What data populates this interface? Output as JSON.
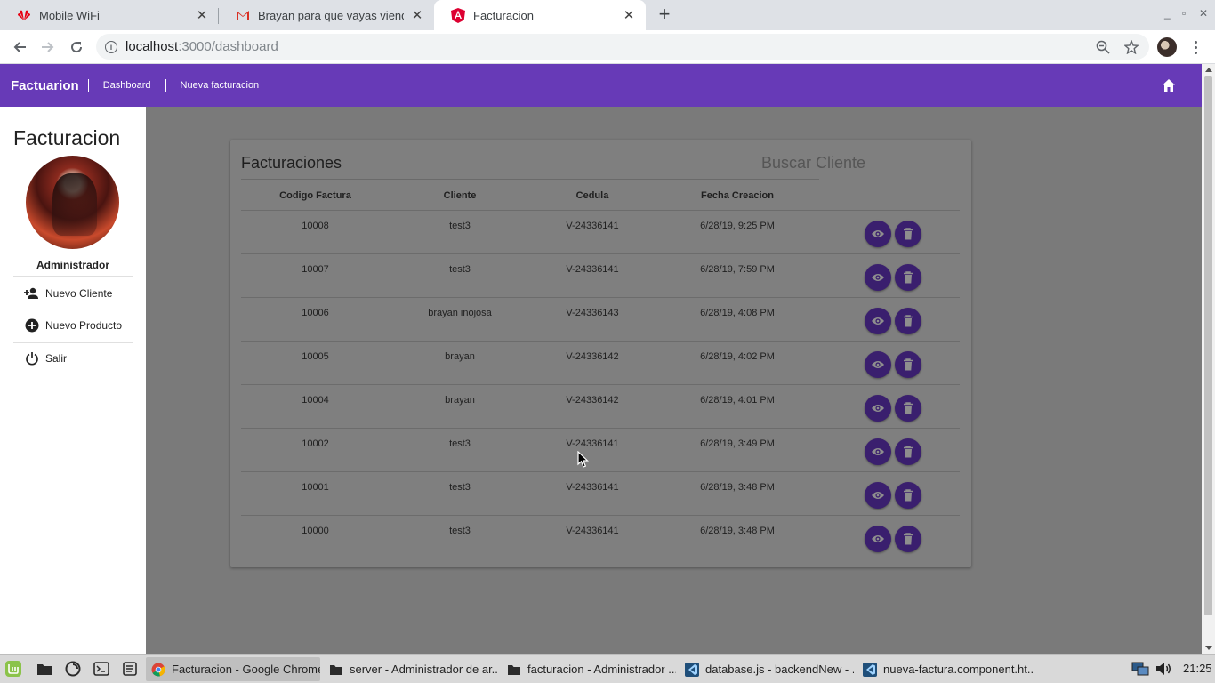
{
  "browser": {
    "tabs": [
      {
        "title": "Mobile WiFi",
        "icon": "huawei-logo-icon",
        "active": false
      },
      {
        "title": "Brayan para que vayas viendo",
        "icon": "gmail-icon",
        "active": false
      },
      {
        "title": "Facturacion",
        "icon": "angular-logo-icon",
        "active": true
      }
    ],
    "address": {
      "host": "localhost",
      "path": ":3000/dashboard"
    }
  },
  "header": {
    "brand": "Factuarion",
    "nav": [
      "Dashboard",
      "Nueva facturacion"
    ]
  },
  "sidebar": {
    "title": "Facturacion",
    "role": "Administrador",
    "items": [
      {
        "label": "Nuevo Cliente",
        "icon": "person-add-icon"
      },
      {
        "label": "Nuevo Producto",
        "icon": "add-circle-icon"
      },
      {
        "label": "Salir",
        "icon": "power-icon"
      }
    ]
  },
  "main": {
    "card_title": "Facturaciones",
    "search_label": "Buscar Cliente",
    "columns": [
      "Codigo Factura",
      "Cliente",
      "Cedula",
      "Fecha Creacion"
    ],
    "rows": [
      [
        "10008",
        "test3",
        "V-24336141",
        "6/28/19, 9:25 PM"
      ],
      [
        "10007",
        "test3",
        "V-24336141",
        "6/28/19, 7:59 PM"
      ],
      [
        "10006",
        "brayan inojosa",
        "V-24336143",
        "6/28/19, 4:08 PM"
      ],
      [
        "10005",
        "brayan",
        "V-24336142",
        "6/28/19, 4:02 PM"
      ],
      [
        "10004",
        "brayan",
        "V-24336142",
        "6/28/19, 4:01 PM"
      ],
      [
        "10002",
        "test3",
        "V-24336141",
        "6/28/19, 3:49 PM"
      ],
      [
        "10001",
        "test3",
        "V-24336141",
        "6/28/19, 3:48 PM"
      ],
      [
        "10000",
        "test3",
        "V-24336141",
        "6/28/19, 3:48 PM"
      ]
    ]
  },
  "taskbar": {
    "tasks": [
      {
        "label": "Facturacion - Google Chrome",
        "icon": "chrome-icon",
        "active": true
      },
      {
        "label": "server - Administrador de ar...",
        "icon": "folder-icon",
        "active": false
      },
      {
        "label": "facturacion - Administrador ...",
        "icon": "folder-icon",
        "active": false
      },
      {
        "label": "database.js - backendNew - ...",
        "icon": "vscode-icon",
        "active": false
      },
      {
        "label": "nueva-factura.component.ht...",
        "icon": "vscode-icon",
        "active": false
      }
    ],
    "clock": "21:25"
  },
  "colors": {
    "primary": "#673ab7",
    "action_button": "#3a1f6e",
    "overlay": "#7a7a7a"
  }
}
